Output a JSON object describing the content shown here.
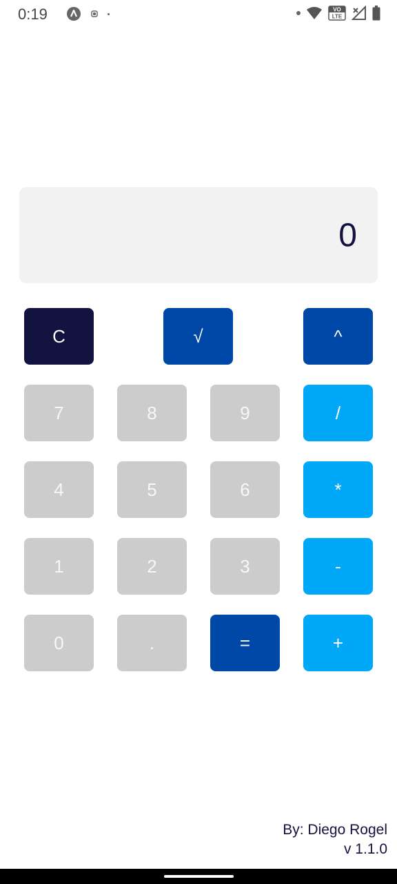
{
  "status_bar": {
    "time": "0:19",
    "icons": [
      "app-notification-icon",
      "record-icon",
      "dot-icon",
      "notification-dot-icon",
      "wifi-icon",
      "volte-icon",
      "no-signal-icon",
      "battery-icon"
    ],
    "volte_label_top": "VO",
    "volte_label_bottom": "LTE"
  },
  "display": {
    "value": "0"
  },
  "keys": {
    "clear": "C",
    "sqrt": "√",
    "power": "^",
    "seven": "7",
    "eight": "8",
    "nine": "9",
    "divide": "/",
    "four": "4",
    "five": "5",
    "six": "6",
    "multiply": "*",
    "one": "1",
    "two": "2",
    "three": "3",
    "minus": "-",
    "zero": "0",
    "dot": ".",
    "equals": "=",
    "plus": "+"
  },
  "footer": {
    "author": "By: Diego Rogel",
    "version": "v 1.1.0"
  },
  "colors": {
    "navy": "#131340",
    "blue": "#0048a8",
    "light_blue": "#00a8f7",
    "gray": "#cccccc",
    "display_bg": "#f2f2f2",
    "text_dark": "#14133f"
  }
}
